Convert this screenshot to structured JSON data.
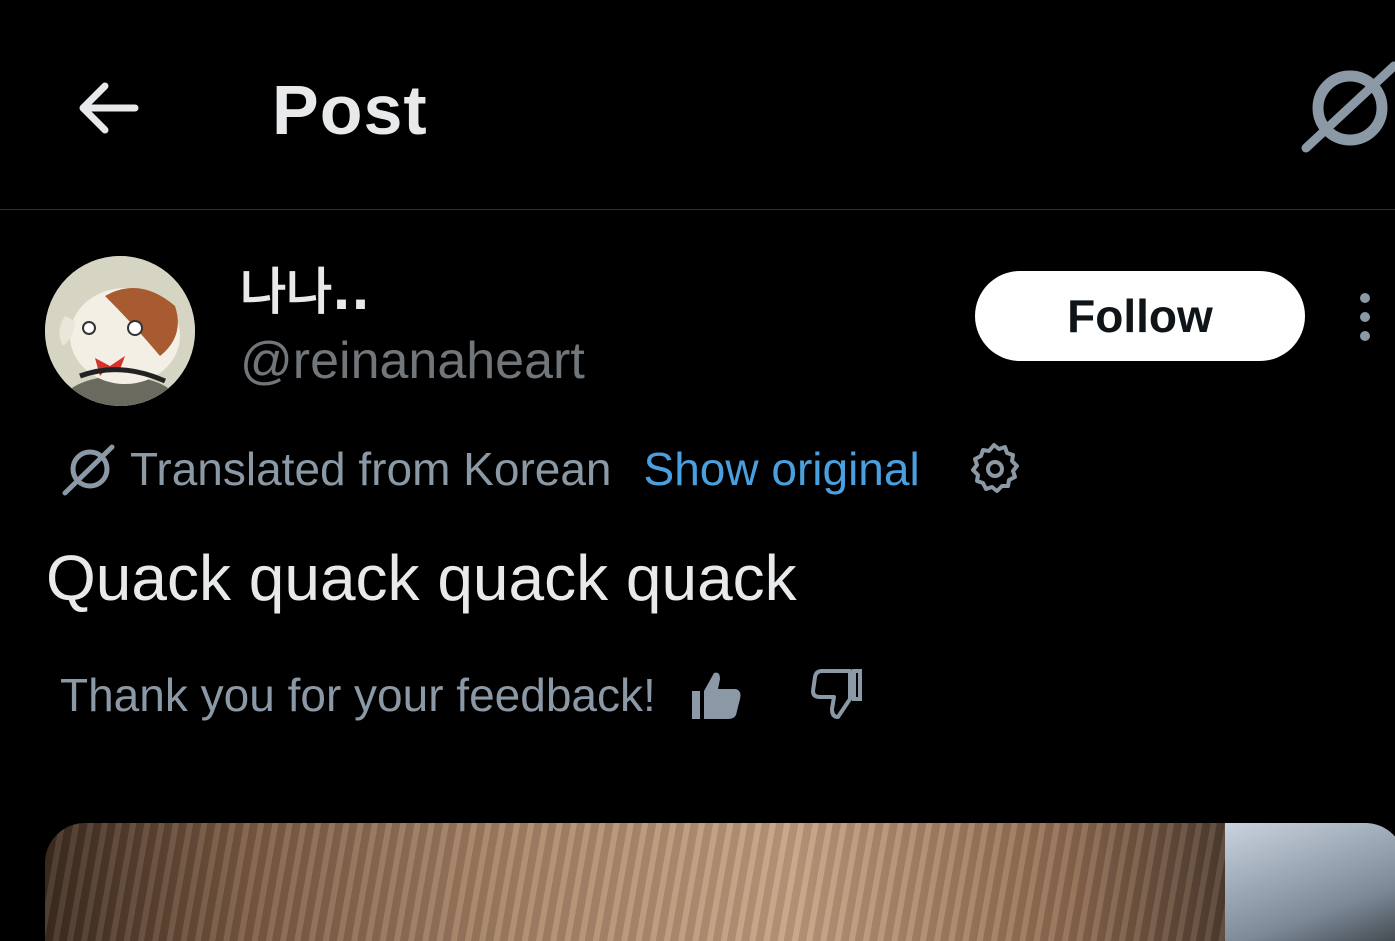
{
  "header": {
    "title": "Post",
    "back_icon": "arrow-left-icon",
    "grok_icon": "grok-icon"
  },
  "author": {
    "display_name": "나나..",
    "handle": "@reinanaheart",
    "follow_label": "Follow"
  },
  "translation": {
    "notice": "Translated from Korean",
    "show_original_label": "Show original"
  },
  "post": {
    "text": "Quack quack quack quack"
  },
  "feedback": {
    "message": "Thank you for your feedback!"
  },
  "colors": {
    "background": "#000000",
    "primary_text": "#e7e9ea",
    "secondary_text": "#71767b",
    "muted_text": "#8b98a5",
    "link": "#4a9fde",
    "follow_bg": "#ffffff",
    "divider": "#2f3336"
  }
}
